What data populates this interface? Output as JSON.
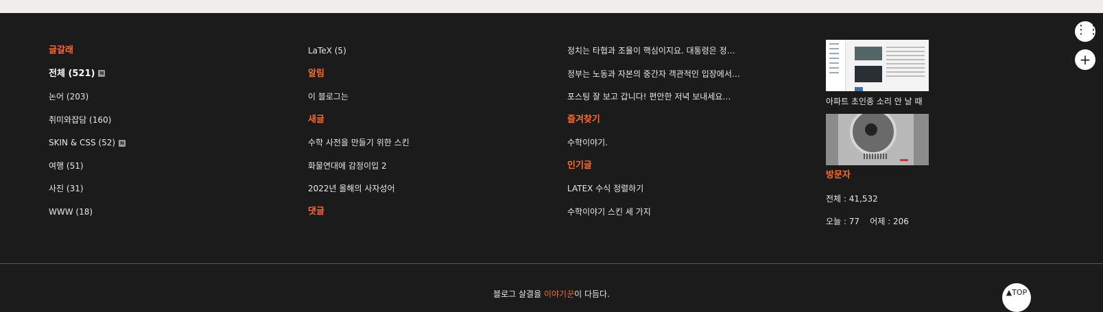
{
  "col1": {
    "heading": "글갈래",
    "total": "전체 (521)",
    "new_badge": "N",
    "items": [
      {
        "label": "논어 (203)",
        "badge": ""
      },
      {
        "label": "취미와잡담 (160)",
        "badge": ""
      },
      {
        "label": "SKIN & CSS (52)",
        "badge": "N"
      },
      {
        "label": "여행 (51)",
        "badge": ""
      },
      {
        "label": "사진 (31)",
        "badge": ""
      },
      {
        "label": "WWW (18)",
        "badge": ""
      }
    ]
  },
  "col2": {
    "latex_category": "LaTeX (5)",
    "notice_heading": "알림",
    "notice_item": "이 블로그는",
    "new_heading": "새글",
    "new_posts": [
      "수학 사전을 만들기 위한 스킨",
      "화물연대에 감정이입 2",
      "2022년 올해의 사자성어"
    ],
    "comments_heading": "댓글"
  },
  "col3": {
    "comments": [
      "정치는 타협과 조율이 핵심이지요. 대통령은 정…",
      "정부는 노동과 자본의 중간자 객관적인 입장에서…",
      "포스팅 잘 보고 갑니다! 편안한 저녁 보내세요…"
    ],
    "favorites_heading": "즐겨찾기",
    "favorite_item": "수학이야기.",
    "popular_heading": "인기글",
    "popular_posts": [
      "LATEX  수식 정렬하기",
      "수학이야기 스킨 세 가지"
    ]
  },
  "col4": {
    "thumb1_caption": "아파트 초인종 소리 안 날 때",
    "visitors_heading": "방문자",
    "total_visitors": "전체 : 41,532",
    "today_yesterday": "오늘 : 77    어제 : 206"
  },
  "footer": {
    "copy_pre": "블로그 살결을 ",
    "copy_link": "이야기꾼",
    "copy_post": "이 다듬다.",
    "top_button": "▲TOP"
  },
  "floating": {
    "menu_icon": "⋮⋮",
    "plus_icon": "+"
  }
}
